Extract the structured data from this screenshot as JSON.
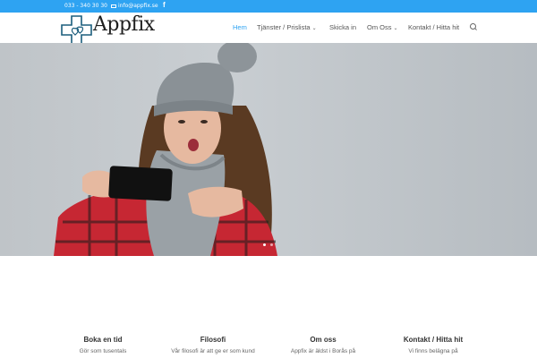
{
  "topbar": {
    "phone": "033 - 340 30 30",
    "email": "info@appfix.se",
    "facebook": "f"
  },
  "header": {
    "brand": "Appfix",
    "nav": [
      {
        "label": "Hem",
        "active": true,
        "dropdown": false
      },
      {
        "label": "Tjänster / Prislista",
        "active": false,
        "dropdown": true
      },
      {
        "label": "Skicka in",
        "active": false,
        "dropdown": false
      },
      {
        "label": "Om Oss",
        "active": false,
        "dropdown": true
      },
      {
        "label": "Kontakt / Hitta hit",
        "active": false,
        "dropdown": false
      }
    ]
  },
  "hero": {
    "slides": 2,
    "active_slide": 1
  },
  "columns": [
    {
      "title": "Boka en tid",
      "text": "Gör som tusentals"
    },
    {
      "title": "Filosofi",
      "text": "Vår filosofi är att ge er som kund"
    },
    {
      "title": "Om oss",
      "text": "Appfix är äldst i Borås på"
    },
    {
      "title": "Kontakt / Hitta hit",
      "text": "Vi finns belägna på"
    }
  ],
  "colors": {
    "accent": "#2ea3f2",
    "logo": "#1b5e7d",
    "text_dark": "#333333"
  },
  "icons": [
    "mail-icon",
    "facebook-icon",
    "logo-cross-hearts-icon",
    "chevron-down-icon",
    "search-icon"
  ]
}
